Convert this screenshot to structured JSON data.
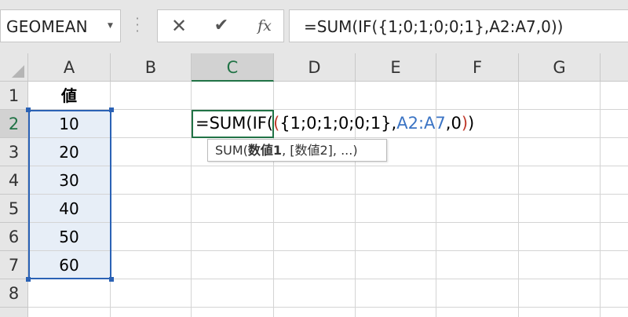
{
  "name_box": {
    "value": "GEOMEAN"
  },
  "formula_bar": {
    "cancel_icon": "✕",
    "enter_icon": "✔",
    "fx_label": "fx",
    "formula": "=SUM(IF({1;0;1;0;0;1},A2:A7,0))"
  },
  "columns": [
    "A",
    "B",
    "C",
    "D",
    "E",
    "F",
    "G"
  ],
  "active_column": "C",
  "rows": [
    "1",
    "2",
    "3",
    "4",
    "5",
    "6",
    "7",
    "8"
  ],
  "column_a": [
    "値",
    "10",
    "20",
    "30",
    "40",
    "50",
    "60",
    ""
  ],
  "active_cell": {
    "address": "C2",
    "parts": {
      "p1": "=SUM(IF(",
      "p2": "(",
      "p3": "{1;0;1;0;0;1},",
      "p4": "A2:A7",
      "p5": ",0",
      "p6": ")",
      "p7": ")"
    }
  },
  "tooltip": {
    "func": "SUM(",
    "arg1": "数値1",
    "rest": ", [数値2], ...)"
  },
  "colors": {
    "excel_green": "#217346",
    "selection_blue": "#2b62b5",
    "paren_red": "#c0392b",
    "ref_blue": "#3b74c4"
  }
}
